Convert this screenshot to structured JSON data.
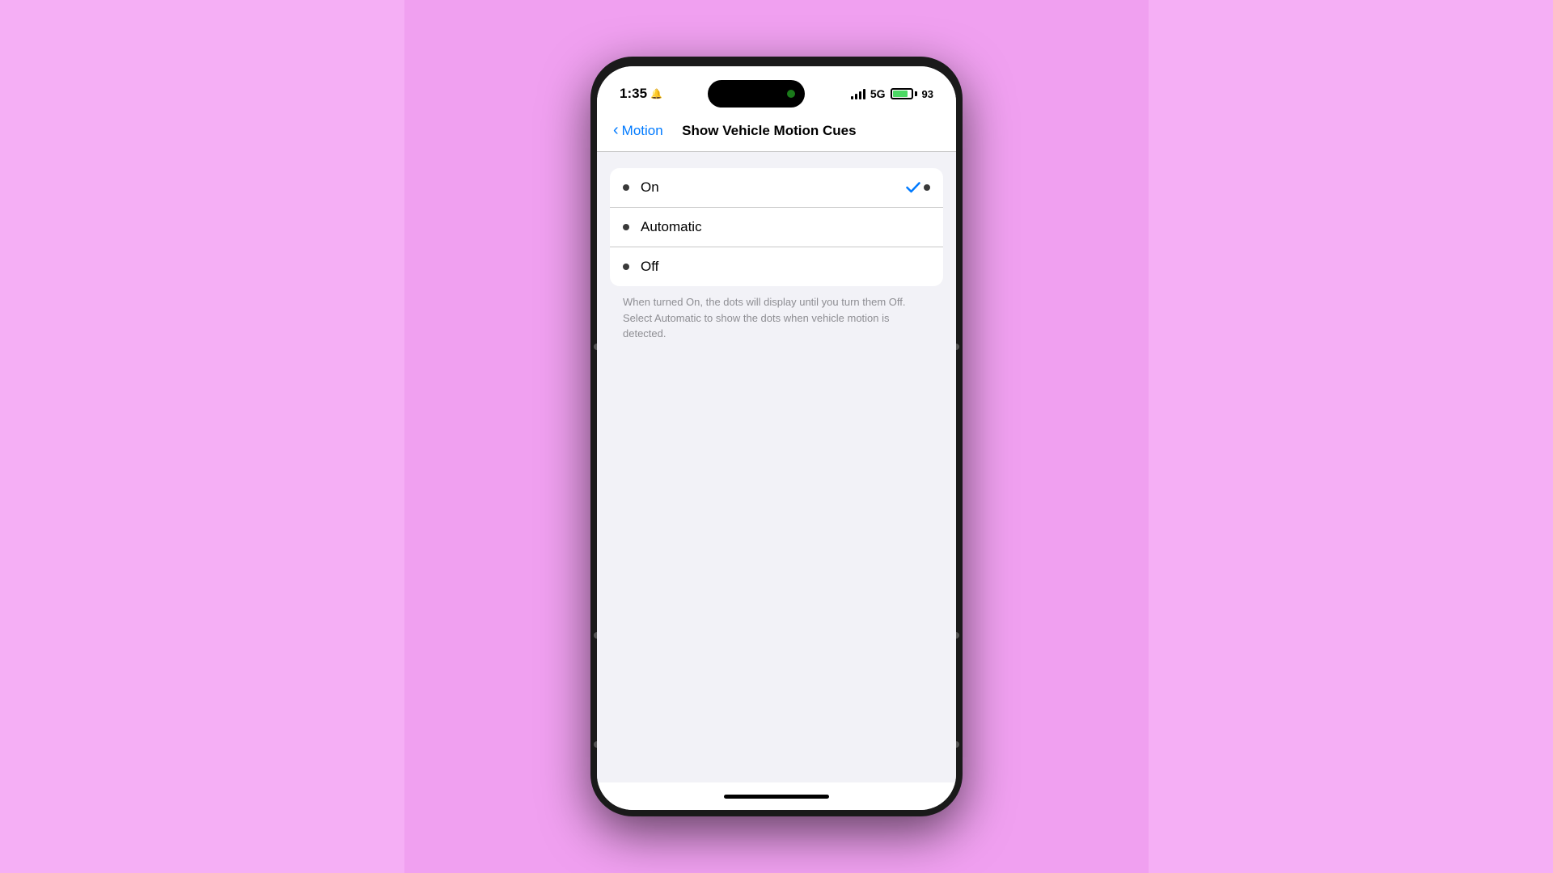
{
  "background": {
    "color": "#f0a0f0"
  },
  "status_bar": {
    "time": "1:35",
    "bell_icon": "🔔",
    "network": "5G",
    "battery_percent": "93"
  },
  "navigation": {
    "back_label": "Motion",
    "page_title": "Show Vehicle Motion Cues"
  },
  "options": [
    {
      "id": "on",
      "label": "On",
      "selected": true
    },
    {
      "id": "automatic",
      "label": "Automatic",
      "selected": false
    },
    {
      "id": "off",
      "label": "Off",
      "selected": false
    }
  ],
  "description": "When turned On, the dots will display until you turn them Off. Select Automatic to show the dots when vehicle motion is detected."
}
